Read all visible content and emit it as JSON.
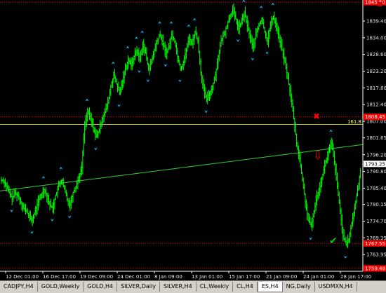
{
  "chart_data": {
    "type": "line",
    "instrument": "ES,H4",
    "y_ticks": [
      1839.4,
      1834.0,
      1828.6,
      1823.2,
      1817.8,
      1812.4,
      1807.0,
      1801.65,
      1796.2,
      1790.8,
      1785.4,
      1780.15,
      1774.7,
      1769.35,
      1763.95
    ],
    "y_tick_labels": [
      "1839.40",
      "1834.00",
      "1828.60",
      "1823.20",
      "1817.80",
      "1812.40",
      "1807.00",
      "1801.65",
      "1796.20",
      "1790.80",
      "1785.40",
      "1780.15",
      "1774.70",
      "1769.35",
      "1763.95"
    ],
    "ylim": [
      1758.55,
      1846.2
    ],
    "x_tick_labels": [
      "12 Dec 01:00",
      "16 Dec 17:00",
      "19 Dec 09:00",
      "24 Dec 01:00",
      "8 Jan 09:00",
      "13 Jan 01:00",
      "15 Jan 17:00",
      "21 Jan 09:00",
      "24 Jan 01:00",
      "28 Jan 17:00"
    ],
    "close_series": [
      1788,
      1786,
      1784,
      1782,
      1784,
      1783,
      1781,
      1779,
      1778,
      1776,
      1775,
      1778,
      1781,
      1783,
      1785,
      1783,
      1780,
      1779,
      1783,
      1786,
      1788,
      1785,
      1782,
      1780,
      1784,
      1786,
      1789,
      1792,
      1806,
      1810,
      1808,
      1805,
      1802,
      1804,
      1808,
      1810,
      1813,
      1818,
      1822,
      1819,
      1816,
      1820,
      1824,
      1827,
      1825,
      1828,
      1830,
      1827,
      1832,
      1829,
      1824,
      1826,
      1830,
      1833,
      1835,
      1832,
      1829,
      1831,
      1835,
      1833,
      1828,
      1824,
      1826,
      1830,
      1834,
      1832,
      1836,
      1833,
      1823,
      1817,
      1814,
      1816,
      1818,
      1822,
      1828,
      1833,
      1835,
      1838,
      1841,
      1843,
      1840,
      1837,
      1839,
      1842,
      1838,
      1834,
      1831,
      1835,
      1838,
      1840,
      1836,
      1833,
      1838,
      1841,
      1838,
      1834,
      1830,
      1826,
      1821,
      1815,
      1808,
      1800,
      1795,
      1788,
      1781,
      1775,
      1773,
      1778,
      1783,
      1786,
      1790,
      1794,
      1797,
      1800,
      1794,
      1786,
      1778,
      1770,
      1767,
      1769,
      1774,
      1779,
      1785,
      1791
    ],
    "price_boxes": [
      {
        "label": "1845.50",
        "value": 1845.5,
        "color": "#ff0000"
      },
      {
        "label": "1808.45",
        "value": 1808.45,
        "color": "#ff0000"
      },
      {
        "label": "1793.25",
        "value": 1793.25,
        "color": "#ffffff"
      },
      {
        "label": "1767.55",
        "value": 1767.55,
        "color": "#ff0000"
      },
      {
        "label": "1759.48",
        "value": 1759.48,
        "color": "#ff0000"
      }
    ],
    "fib_level": {
      "label": "161.8",
      "value": 1806.0
    },
    "horizontal_lines": [
      1845.5,
      1808.45,
      1767.55,
      1759.48
    ],
    "trendline": {
      "from": 1784.5,
      "to": 1799.5
    }
  },
  "top_right_marker": "■",
  "signals": {
    "sell_mark": "✖",
    "down_arrow": "⇩",
    "check_mark": "✔"
  },
  "tabs": [
    {
      "label": "CADJPY,H4"
    },
    {
      "label": "GOLD,Weekly"
    },
    {
      "label": "GOLD,H4"
    },
    {
      "label": "SILVER,Daily"
    },
    {
      "label": "SILVER,H4"
    },
    {
      "label": "CL,Weekly"
    },
    {
      "label": "CL,H4"
    },
    {
      "label": "ES,H4",
      "active": true
    },
    {
      "label": "NG,Daily"
    },
    {
      "label": "USDMXN,H4"
    }
  ],
  "colors": {
    "bars": "#00ff00",
    "up_arrow": "#00bfff",
    "grid_red": "#ff0000",
    "fib": "#c8c800",
    "trend": "#33cc33"
  }
}
